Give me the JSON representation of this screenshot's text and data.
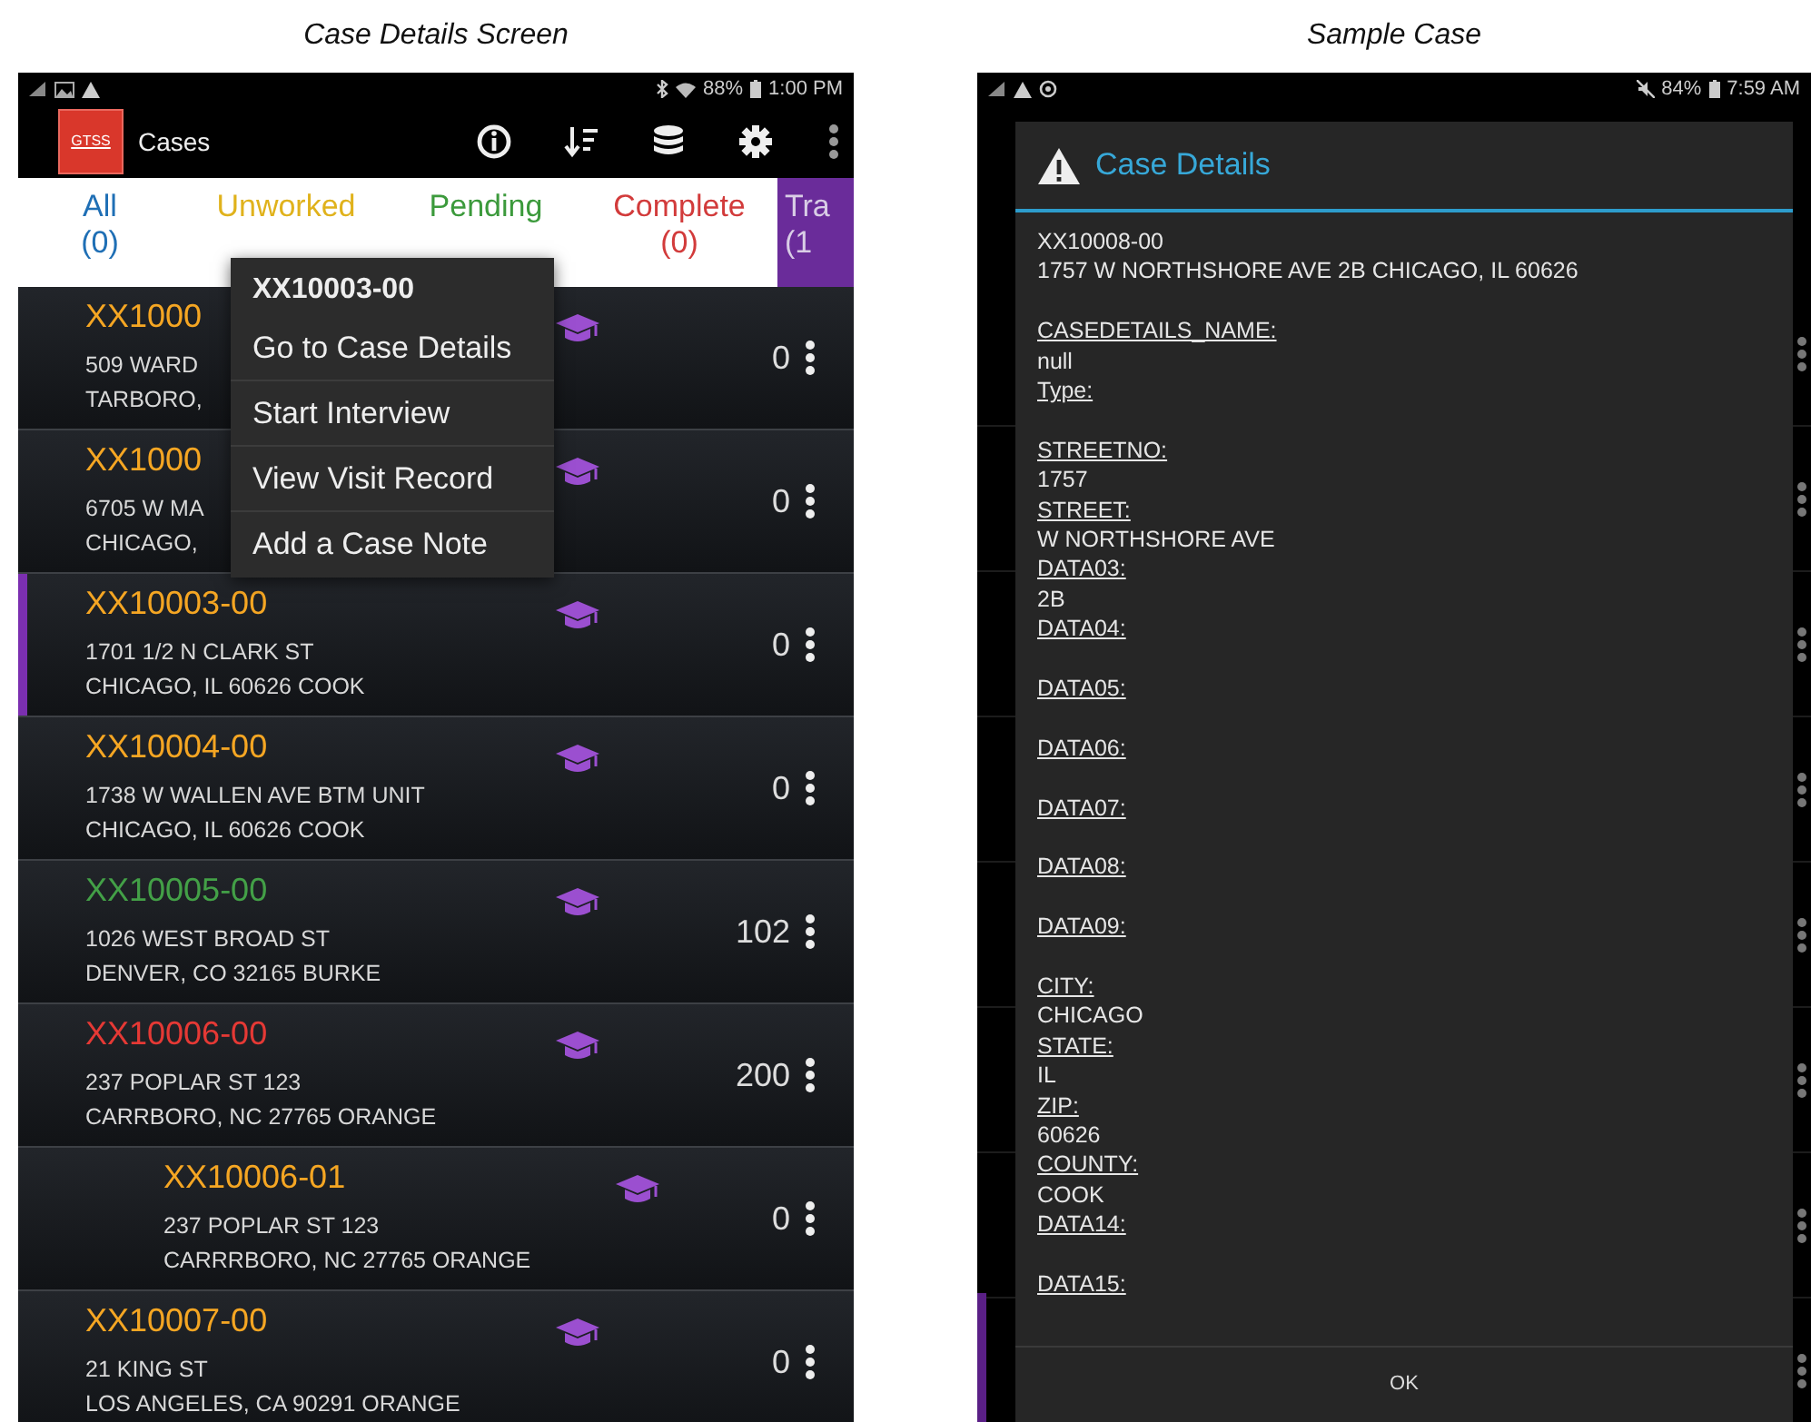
{
  "captions": [
    "Case Details Screen",
    "Sample Case"
  ],
  "left_screen": {
    "status_bar": {
      "battery": "88%",
      "time": "1:00 PM"
    },
    "app_bar": {
      "logo": "GTSS",
      "title": "Cases"
    },
    "tabs": [
      {
        "label": "All",
        "count": "(0)",
        "color": "#1f6fb5",
        "selected": false
      },
      {
        "label": "Unworked",
        "color": "#e0b21c",
        "selected": false
      },
      {
        "label": "Pending",
        "color": "#3c9a3c",
        "selected": false
      },
      {
        "label": "Complete",
        "count": "(0)",
        "color": "#d23b3b",
        "selected": false
      },
      {
        "label": "Tra",
        "count": "(1",
        "color": "#d9cde6",
        "selected": true
      }
    ],
    "cases": [
      {
        "id": "XX1000",
        "address": [
          "509 WARD",
          "TARBORO,"
        ],
        "count": "0",
        "color": "#f5a623",
        "selected": false
      },
      {
        "id": "XX1000",
        "address": [
          "6705 W MA",
          "CHICAGO,"
        ],
        "count": "0",
        "color": "#f5a623",
        "selected": false
      },
      {
        "id": "XX10003-00",
        "address": [
          "1701 1/2 N CLARK ST",
          "CHICAGO, IL 60626 COOK"
        ],
        "count": "0",
        "color": "#f5a623",
        "selected": true
      },
      {
        "id": "XX10004-00",
        "address": [
          "1738 W WALLEN AVE BTM UNIT",
          "CHICAGO, IL 60626 COOK"
        ],
        "count": "0",
        "color": "#f5a623",
        "selected": false
      },
      {
        "id": "XX10005-00",
        "address": [
          "1026 WEST BROAD ST",
          "DENVER, CO 32165 BURKE"
        ],
        "count": "102",
        "color": "#43a047",
        "selected": false
      },
      {
        "id": "XX10006-00",
        "address": [
          "237 POPLAR ST 123",
          "CARRBORO, NC 27765 ORANGE"
        ],
        "count": "200",
        "color": "#e53935",
        "selected": false,
        "children": [
          {
            "id": "XX10006-01",
            "address": [
              "237 POPLAR ST 123",
              "CARRRBORO, NC 27765 ORANGE"
            ],
            "count": "0",
            "color": "#f5a623",
            "selected": false
          }
        ]
      },
      {
        "id": "XX10007-00",
        "address": [
          "21 KING ST",
          "LOS ANGELES, CA 90291 ORANGE"
        ],
        "count": "0",
        "color": "#f5a623",
        "selected": false
      }
    ],
    "context_menu": {
      "title": "XX10003-00",
      "items": [
        "Go to Case Details",
        "Start Interview",
        "View Visit Record",
        "Add a Case Note"
      ]
    }
  },
  "right_screen": {
    "status_bar": {
      "battery": "84%",
      "time": "7:59 AM"
    },
    "dialog": {
      "title": "Case Details",
      "sections": [
        [
          {
            "kind": "value",
            "text": "XX10008-00"
          },
          {
            "kind": "value",
            "text": "1757 W NORTHSHORE AVE 2B CHICAGO, IL 60626"
          }
        ],
        [
          {
            "kind": "label",
            "text": "CASEDETAILS_NAME:"
          },
          {
            "kind": "value",
            "text": "null"
          },
          {
            "kind": "label",
            "text": "Type:"
          }
        ],
        [
          {
            "kind": "label",
            "text": "STREETNO:"
          },
          {
            "kind": "value",
            "text": "1757"
          },
          {
            "kind": "label",
            "text": "STREET:"
          },
          {
            "kind": "value",
            "text": "W NORTHSHORE AVE"
          },
          {
            "kind": "label",
            "text": "DATA03:"
          },
          {
            "kind": "value",
            "text": "2B"
          },
          {
            "kind": "label",
            "text": "DATA04:"
          }
        ],
        [
          {
            "kind": "label",
            "text": "DATA05:"
          }
        ],
        [
          {
            "kind": "label",
            "text": "DATA06:"
          }
        ],
        [
          {
            "kind": "label",
            "text": "DATA07:"
          }
        ],
        [
          {
            "kind": "label",
            "text": "DATA08:"
          }
        ],
        [
          {
            "kind": "label",
            "text": "DATA09:"
          }
        ],
        [
          {
            "kind": "label",
            "text": "CITY:"
          },
          {
            "kind": "value",
            "text": "CHICAGO"
          },
          {
            "kind": "label",
            "text": "STATE:"
          },
          {
            "kind": "value",
            "text": "IL"
          },
          {
            "kind": "label",
            "text": "ZIP:"
          },
          {
            "kind": "value",
            "text": "60626"
          },
          {
            "kind": "label",
            "text": "COUNTY:"
          },
          {
            "kind": "value",
            "text": "COOK"
          },
          {
            "kind": "label",
            "text": "DATA14:"
          }
        ],
        [
          {
            "kind": "label",
            "text": "DATA15:"
          }
        ]
      ],
      "button": "OK"
    }
  }
}
